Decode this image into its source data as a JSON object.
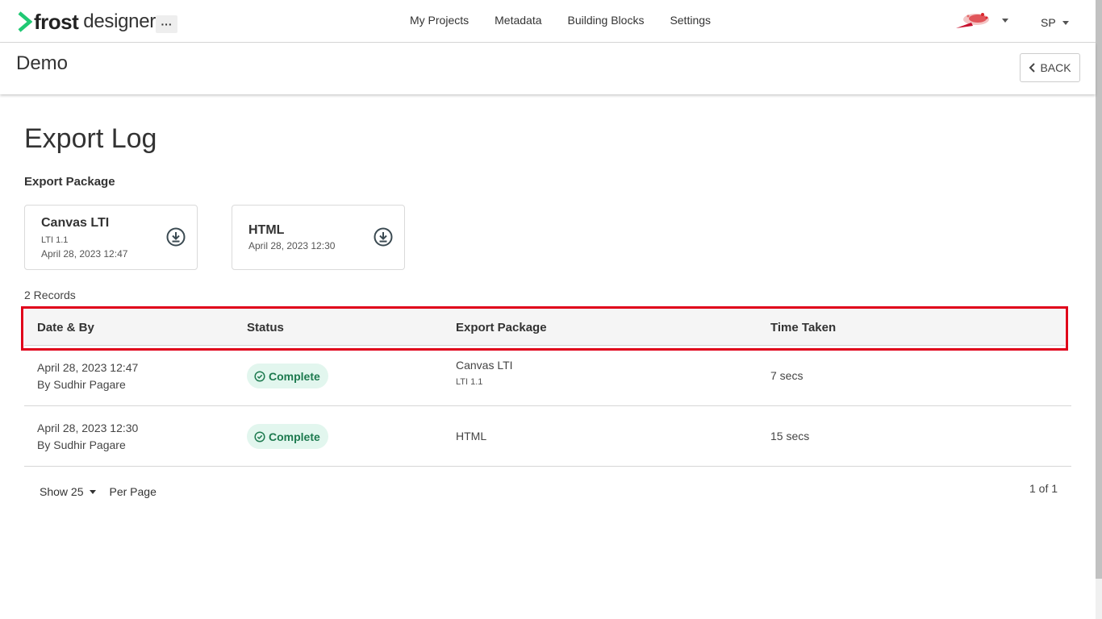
{
  "app": {
    "brand_bold": "frost",
    "brand_rest": "designer",
    "more_label": "···"
  },
  "nav": {
    "items": [
      "My Projects",
      "Metadata",
      "Building Blocks",
      "Settings"
    ]
  },
  "user": {
    "initials": "SP"
  },
  "project": {
    "title": "Demo",
    "back_label": "BACK"
  },
  "page": {
    "title": "Export Log",
    "section_label": "Export Package",
    "records_count": "2 Records"
  },
  "packages": [
    {
      "name": "Canvas LTI",
      "sub": "LTI 1.1",
      "date": "April 28, 2023 12:47"
    },
    {
      "name": "HTML",
      "date": "April 28, 2023 12:30"
    }
  ],
  "table": {
    "headers": [
      "Date & By",
      "Status",
      "Export Package",
      "Time Taken"
    ],
    "rows": [
      {
        "date": "April 28, 2023 12:47",
        "by": "By Sudhir Pagare",
        "status": "Complete",
        "package": "Canvas LTI",
        "package_sub": "LTI 1.1",
        "time": "7 secs"
      },
      {
        "date": "April 28, 2023 12:30",
        "by": "By Sudhir Pagare",
        "status": "Complete",
        "package": "HTML",
        "package_sub": "",
        "time": "15 secs"
      }
    ]
  },
  "pagination": {
    "show_label": "Show 25",
    "per_page_label": "Per Page",
    "page_info": "1 of 1"
  },
  "colors": {
    "brand_green": "#20c974",
    "status_bg": "#e2f6ee",
    "status_text": "#1d7a4f",
    "highlight": "#e0001a"
  }
}
